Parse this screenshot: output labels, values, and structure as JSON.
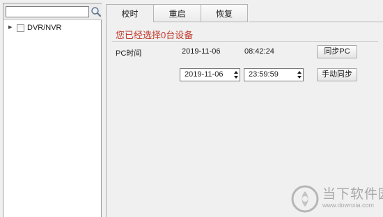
{
  "search": {
    "value": "",
    "placeholder": ""
  },
  "tree": {
    "items": [
      {
        "label": "DVR/NVR",
        "expanded": false,
        "checked": false
      }
    ]
  },
  "tabs": [
    {
      "label": "校时",
      "active": true
    },
    {
      "label": "重启",
      "active": false
    },
    {
      "label": "恢复",
      "active": false
    }
  ],
  "status": {
    "message": "您已经选择0台设备",
    "color": "#c0392b"
  },
  "pc_time": {
    "label": "PC时间",
    "date": "2019-11-06",
    "time": "08:42:24",
    "sync_button": "同步PC"
  },
  "manual": {
    "date": "2019-11-06",
    "time": "23:59:59",
    "sync_button": "手动同步"
  },
  "watermark": {
    "title": "当下软件园",
    "url": "www.downxia.com"
  }
}
